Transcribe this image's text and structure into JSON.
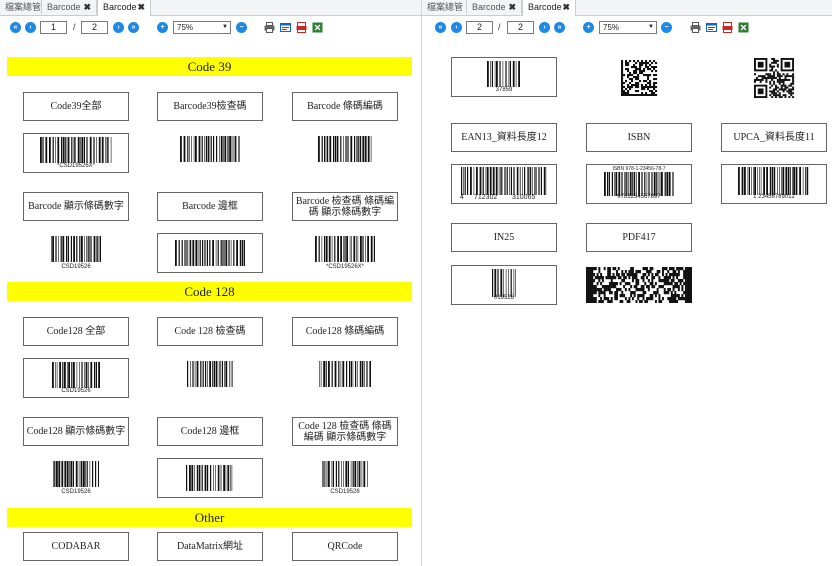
{
  "left": {
    "tabs": [
      {
        "label": "檔案總管",
        "closable": false,
        "active": false
      },
      {
        "label": "Barcode",
        "closable": true,
        "active": false
      },
      {
        "label": "Barcode",
        "closable": true,
        "active": true
      }
    ],
    "toolbar": {
      "page": "1",
      "sep": "/",
      "total": "2",
      "zoom": "75%"
    },
    "sections": [
      {
        "title": "Code 39",
        "rows": [
          {
            "labels": [
              "Code39全部",
              "Barcode39檢查碼",
              "Barcode 條碼編碼"
            ],
            "barcodes": [
              {
                "caption": "*CSD19526X*",
                "framed": true,
                "top": ""
              },
              {
                "caption": "",
                "framed": false,
                "top": ""
              },
              {
                "caption": "",
                "framed": false,
                "top": ""
              }
            ]
          },
          {
            "labels": [
              "Barcode 顯示條碼數字",
              "Barcode 邊框",
              "Barcode 檢查碼 條碼編碼 顯示條碼數字"
            ],
            "barcodes": [
              {
                "caption": "CSD19526",
                "framed": false,
                "top": ""
              },
              {
                "caption": "",
                "framed": true,
                "top": ""
              },
              {
                "caption": "*CSD19526X*",
                "framed": false,
                "top": ""
              }
            ]
          }
        ]
      },
      {
        "title": "Code 128",
        "rows": [
          {
            "labels": [
              "Code128 全部",
              "Code 128 檢查碼",
              "Code128 條碼編碼"
            ],
            "barcodes": [
              {
                "caption": "CSD19526",
                "framed": true,
                "top": ""
              },
              {
                "caption": "",
                "framed": false,
                "top": ""
              },
              {
                "caption": "",
                "framed": false,
                "top": ""
              }
            ]
          },
          {
            "labels": [
              "Code128 顯示條碼數字",
              "Code128 邊框",
              "Code 128 檢查碼 條碼編碼 顯示條碼數字"
            ],
            "barcodes": [
              {
                "caption": "CSD19526",
                "framed": false,
                "top": ""
              },
              {
                "caption": "",
                "framed": true,
                "top": ""
              },
              {
                "caption": "CSD19526",
                "framed": false,
                "top": ""
              }
            ]
          }
        ]
      },
      {
        "title": "Other",
        "rows": [
          {
            "labels": [
              "CODABAR",
              "DataMatrix網址",
              "QRCode"
            ],
            "barcodes": []
          }
        ]
      }
    ]
  },
  "right": {
    "tabs": [
      {
        "label": "檔案總管",
        "closable": false,
        "active": false
      },
      {
        "label": "Barcode",
        "closable": true,
        "active": false
      },
      {
        "label": "Barcode",
        "closable": true,
        "active": true
      }
    ],
    "toolbar": {
      "page": "2",
      "sep": "/",
      "total": "2",
      "zoom": "75%"
    },
    "top_barcode_caption": "37859",
    "labels_row1": [
      "EAN13_資料長度12",
      "ISBN",
      "UPCA_資料長度11"
    ],
    "ean13": {
      "left": "4",
      "mid": "712302",
      "right": "310065"
    },
    "isbn": {
      "top": "ISBN 978-1-23456-78-7",
      "caption": "9781234567897"
    },
    "upca": {
      "caption": "1 23456789012"
    },
    "labels_row2": [
      "IN25",
      "PDF417"
    ],
    "in25_caption": "019526"
  },
  "colors": {
    "accent": "#1e88e5",
    "section": "#ffff00",
    "tab_bg": "#f3f4f6"
  }
}
